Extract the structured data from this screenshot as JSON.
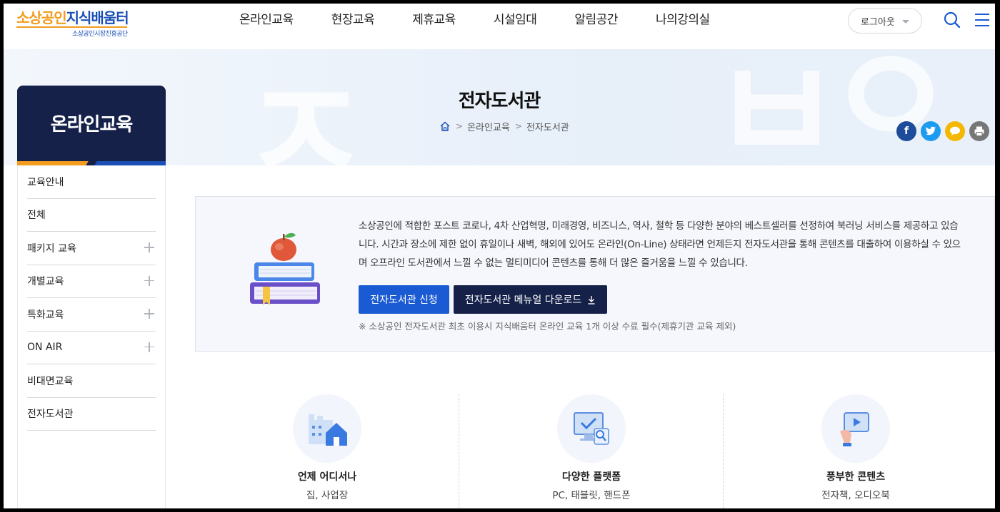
{
  "logo": {
    "main_a": "소상공인",
    "main_b": "지식배움터",
    "sub": "소상공인시장진흥공단"
  },
  "gnb": [
    "온라인교육",
    "현장교육",
    "제휴교육",
    "시설임대",
    "알림공간",
    "나의강의실"
  ],
  "header": {
    "logout_label": "로그아웃",
    "icons": [
      "search-icon",
      "menu-icon"
    ]
  },
  "visual": {
    "title": "전자도서관",
    "breadcrumb": {
      "home_icon": "home-icon",
      "level1": "온라인교육",
      "level2": "전자도서관"
    },
    "share": [
      {
        "name": "facebook",
        "glyph": "f",
        "color": "#1f4c9a"
      },
      {
        "name": "twitter",
        "glyph": "t",
        "color": "#1d9bf0"
      },
      {
        "name": "kakaostory",
        "glyph": "",
        "color": "#f5b800"
      },
      {
        "name": "print",
        "glyph": "",
        "color": "#777777"
      }
    ]
  },
  "side": {
    "title": "온라인교육",
    "items": [
      {
        "label": "교육안내",
        "expandable": false
      },
      {
        "label": "전체",
        "expandable": false
      },
      {
        "label": "패키지 교육",
        "expandable": true
      },
      {
        "label": "개별교육",
        "expandable": true
      },
      {
        "label": "특화교육",
        "expandable": true
      },
      {
        "label": "ON AIR",
        "expandable": true
      },
      {
        "label": "비대면교육",
        "expandable": false
      },
      {
        "label": "전자도서관",
        "expandable": false
      }
    ]
  },
  "info": {
    "text": "소상공인에 적합한 포스트 코로나, 4차 산업혁명, 미래경영, 비즈니스, 역사, 철학 등 다양한 분야의 베스트셀러를 선정하여 북러닝 서비스를 제공하고 있습니다. 시간과 장소에 제한 없이 휴일이나 새벽, 해외에 있어도 온라인(On-Line) 상태라면 언제든지 전자도서관을 통해 콘텐츠를 대출하여 이용하실 수 있으며 오프라인 도서관에서 느낄 수 없는 멀티미디어 콘텐츠를 통해 더 많은 즐거움을 느낄 수 있습니다.",
    "apply_label": "전자도서관 신청",
    "manual_label": "전자도서관 메뉴얼 다운로드",
    "note": "※ 소상공인 전자도서관 최초 이용시 지식배움터 온라인 교육 1개 이상 수료 필수(제휴기관 교육 제외)"
  },
  "features": [
    {
      "title": "언제 어디서나",
      "sub": "집, 사업장",
      "icon": "building-home-icon"
    },
    {
      "title": "다양한 플랫폼",
      "sub": "PC, 태블릿, 핸드폰",
      "icon": "monitor-check-icon"
    },
    {
      "title": "풍부한 콘텐츠",
      "sub": "전자책, 오디오북",
      "icon": "video-play-icon"
    }
  ],
  "colors": {
    "accent_orange": "#f29c1f",
    "brand_blue": "#1a4fb5",
    "navy": "#16214a",
    "apply_blue": "#1a5bd4"
  }
}
